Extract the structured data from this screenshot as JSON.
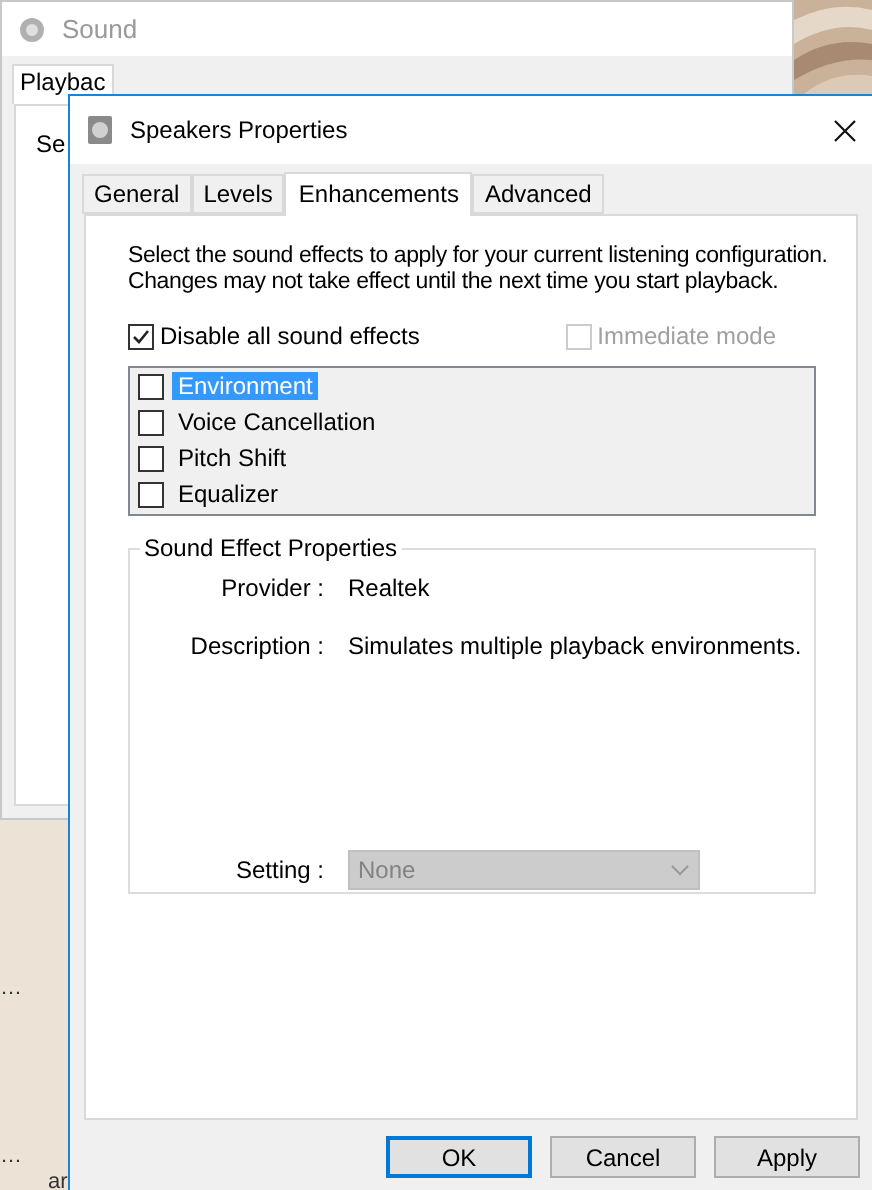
{
  "background_window": {
    "title": "Sound",
    "tabs": [
      {
        "label": "Playbac",
        "selected": true
      }
    ],
    "text_fragment": "Se"
  },
  "desktop": {
    "icon_labels": [
      "…",
      "…",
      "ar"
    ]
  },
  "dialog": {
    "title": "Speakers Properties",
    "tabs": [
      {
        "label": "General",
        "selected": false
      },
      {
        "label": "Levels",
        "selected": false
      },
      {
        "label": "Enhancements",
        "selected": true
      },
      {
        "label": "Advanced",
        "selected": false
      }
    ],
    "instructions": "Select the sound effects to apply for your current listening configuration. Changes may not take effect until the next time you start playback.",
    "disable_all": {
      "label": "Disable all sound effects",
      "checked": true,
      "disabled": false
    },
    "immediate_mode": {
      "label": "Immediate mode",
      "checked": false,
      "disabled": true
    },
    "effects": [
      {
        "label": "Environment",
        "checked": false,
        "selected": true
      },
      {
        "label": "Voice Cancellation",
        "checked": false,
        "selected": false
      },
      {
        "label": "Pitch Shift",
        "checked": false,
        "selected": false
      },
      {
        "label": "Equalizer",
        "checked": false,
        "selected": false
      }
    ],
    "properties": {
      "title": "Sound Effect Properties",
      "rows": [
        {
          "label": "Provider :",
          "value": "Realtek"
        },
        {
          "label": "Description :",
          "value": "Simulates multiple playback environments."
        }
      ],
      "setting": {
        "label": "Setting :",
        "value": "None",
        "disabled": true
      }
    },
    "buttons": [
      {
        "label": "OK",
        "default": true
      },
      {
        "label": "Cancel",
        "default": false
      },
      {
        "label": "Apply",
        "default": false
      }
    ]
  }
}
